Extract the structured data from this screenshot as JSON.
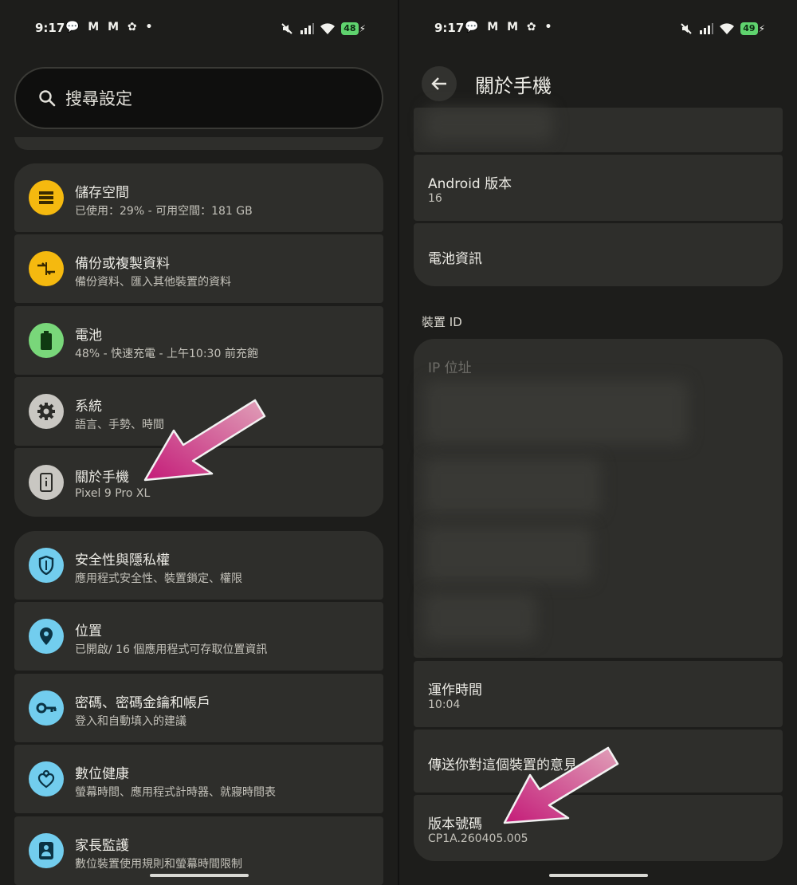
{
  "left": {
    "status": {
      "time": "9:17",
      "battery": "48"
    },
    "search": {
      "placeholder": "搜尋設定"
    },
    "groups": [
      [
        {
          "title": "儲存空間",
          "subtitle": "已使用：29% - 可用空間：181 GB",
          "icon": "storage-icon",
          "color": "#f5b90f"
        },
        {
          "title": "備份或複製資料",
          "subtitle": "備份資料、匯入其他裝置的資料",
          "icon": "transfer-icon",
          "color": "#f5b90f"
        },
        {
          "title": "電池",
          "subtitle": "48% - 快速充電 - 上午10:30 前充飽",
          "icon": "battery-icon",
          "color": "#79d77a"
        },
        {
          "title": "系統",
          "subtitle": "語言、手勢、時間",
          "icon": "gear-icon",
          "color": "#c9c7c2"
        },
        {
          "title": "關於手機",
          "subtitle": "Pixel 9 Pro XL",
          "icon": "phone-info-icon",
          "color": "#c9c7c2"
        }
      ],
      [
        {
          "title": "安全性與隱私權",
          "subtitle": "應用程式安全性、裝置鎖定、權限",
          "icon": "shield-icon",
          "color": "#72cdee"
        },
        {
          "title": "位置",
          "subtitle": "已開啟/ 16 個應用程式可存取位置資訊",
          "icon": "location-icon",
          "color": "#72cdee"
        },
        {
          "title": "密碼、密碼金鑰和帳戶",
          "subtitle": "登入和自動填入的建議",
          "icon": "key-icon",
          "color": "#72cdee"
        },
        {
          "title": "數位健康",
          "subtitle": "螢幕時間、應用程式計時器、就寢時間表",
          "icon": "wellbeing-icon",
          "color": "#72cdee"
        },
        {
          "title": "家長監護",
          "subtitle": "數位裝置使用規則和螢幕時間限制",
          "icon": "parental-icon",
          "color": "#72cdee"
        }
      ]
    ]
  },
  "right": {
    "status": {
      "time": "9:17",
      "battery": "49"
    },
    "title": "關於手機",
    "items": {
      "android_version": {
        "title": "Android 版本",
        "subtitle": "16"
      },
      "battery_info": {
        "title": "電池資訊"
      },
      "section_device_id": "裝置 ID",
      "ip_address": {
        "title": "IP 位址"
      },
      "uptime": {
        "title": "運作時間",
        "subtitle": "10:04"
      },
      "feedback": {
        "title": "傳送你對這個裝置的意見"
      },
      "build_number": {
        "title": "版本號碼",
        "subtitle": "CP1A.260405.005"
      }
    }
  }
}
